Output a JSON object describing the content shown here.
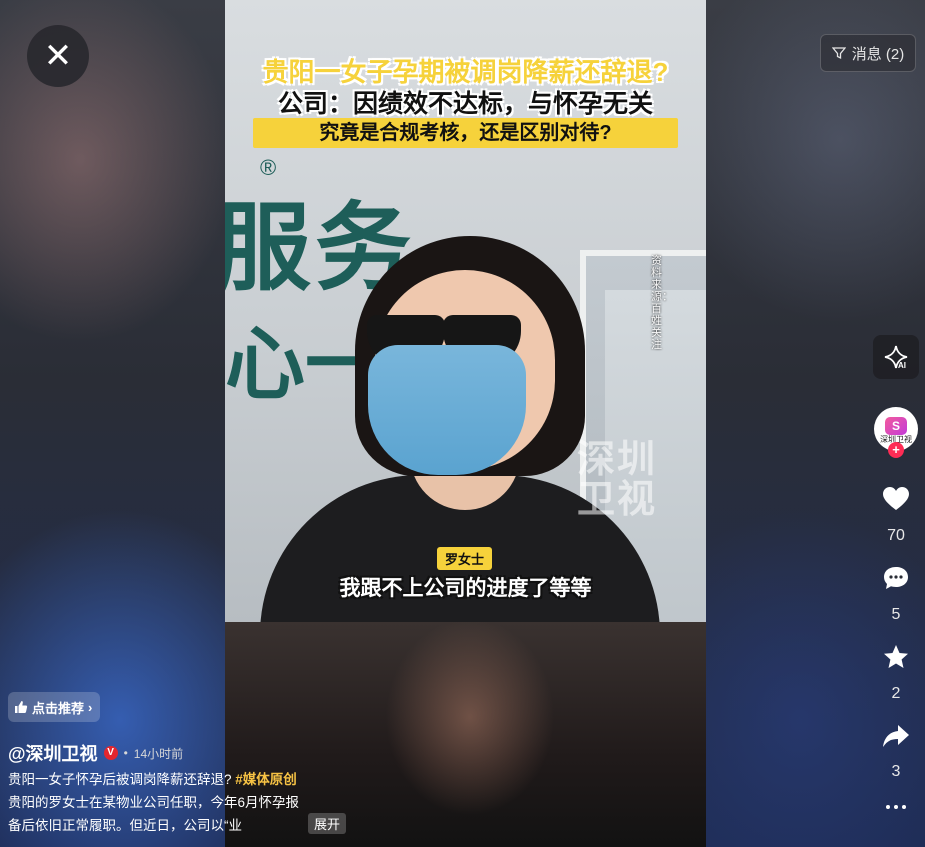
{
  "close": {
    "label": "✕"
  },
  "messages": {
    "label": "消息 (2)"
  },
  "video": {
    "headline_line1": "贵阳一女子孕期被调岗降薪还辞退?",
    "headline_line2": "公司：因绩效不达标，与怀孕无关",
    "headline_banner": "究竟是合规考核，还是区别对待?",
    "side_watermark": "资料来源：百姓关注",
    "wall_sign": "服务",
    "wall_sign2": "心一",
    "wall_reg": "®",
    "brand_watermark_line1": "深圳",
    "brand_watermark_line2": "卫视",
    "speaker": "罗女士",
    "subtitle": "我跟不上公司的进度了等等"
  },
  "rail": {
    "ai_label": "AI",
    "avatar_text": "深圳卫视",
    "avatar_logo": "S",
    "follow_plus": "+",
    "likes": "70",
    "comments": "5",
    "favorites": "2",
    "shares": "3"
  },
  "info": {
    "recommend_label": "点击推荐",
    "author": "@深圳卫视",
    "verify": "V",
    "dot": "•",
    "time": "14小时前",
    "desc_text1": "贵阳一女子怀孕后被调岗降薪还辞退? ",
    "desc_tag": "#媒体原创",
    "desc_text2": " 贵阳的罗女士在某物业公司任职，今年6月怀孕报备后依旧正常履职。但近日，公司以“业",
    "expand_label": "展开"
  },
  "colors": {
    "accent_yellow": "#f6d23b",
    "like_red": "#fe2c55",
    "tag_gold": "#f6c244"
  }
}
